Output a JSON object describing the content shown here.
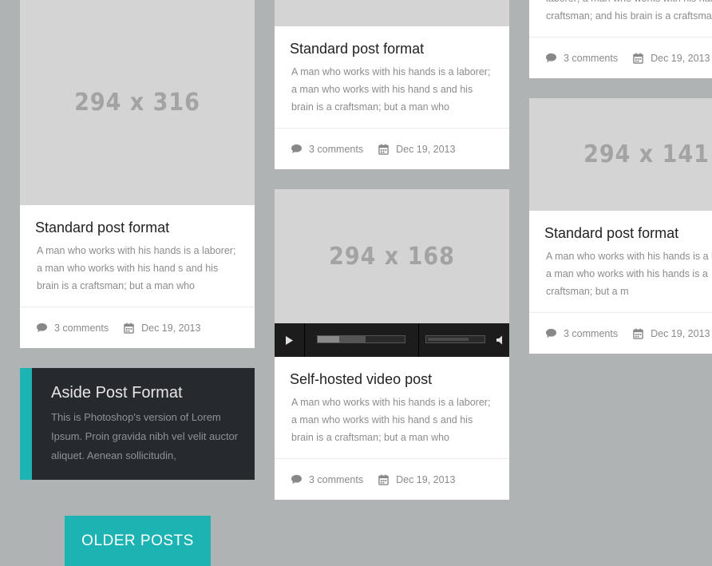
{
  "posts": [
    {
      "image_label": "294 x 316",
      "title": "Standard post format",
      "excerpt": "A man who works with his hands is a laborer; a man who works with his hand s and his brain is a craftsman; but a man who",
      "comments": "3 comments",
      "date": "Dec 19, 2013"
    },
    {
      "title": "Standard post format",
      "excerpt": "A man who works with his hands is a laborer; a man who works with his hand s and his brain is a craftsman; but a man who",
      "comments": "3 comments",
      "date": "Dec 19, 2013"
    },
    {
      "image_label": "294 x 168",
      "title": "Self-hosted video post",
      "excerpt": "A man who works with his hands is a laborer; a man who works with his hand s and his brain is a craftsman; but a man who",
      "comments": "3 comments",
      "date": "Dec 19, 2013",
      "video": {
        "progress_loaded": 0.55,
        "progress_played": 0.25,
        "volume": 0.75
      }
    },
    {
      "excerpt": "laborer; a man who works with his hands is a craftsman; and his brain is a craftsman; but a man who",
      "comments": "3 comments",
      "date": "Dec 19, 2013"
    },
    {
      "image_label": "294 x 141",
      "title": "Standard post format",
      "excerpt": "A man who works with his hands is a laborer; a man who works with his hands is a craftsman; but a m",
      "comments": "3 comments",
      "date": "Dec 19, 2013"
    }
  ],
  "aside": {
    "title": "Aside Post Format",
    "text": "This is Photoshop's version  of Lorem Ipsum. Proin gravida nibh vel velit auctor aliquet. Aenean sollicitudin,"
  },
  "older_posts_label": "OLDER POSTS",
  "icons": {
    "comment": "comment-icon",
    "calendar": "calendar-icon",
    "play": "play-icon",
    "volume": "volume-icon"
  },
  "colors": {
    "background": "#b0b3b3",
    "accent": "#1eb3b3",
    "aside_background": "#262a2e",
    "placeholder": "#d4d4d4"
  }
}
